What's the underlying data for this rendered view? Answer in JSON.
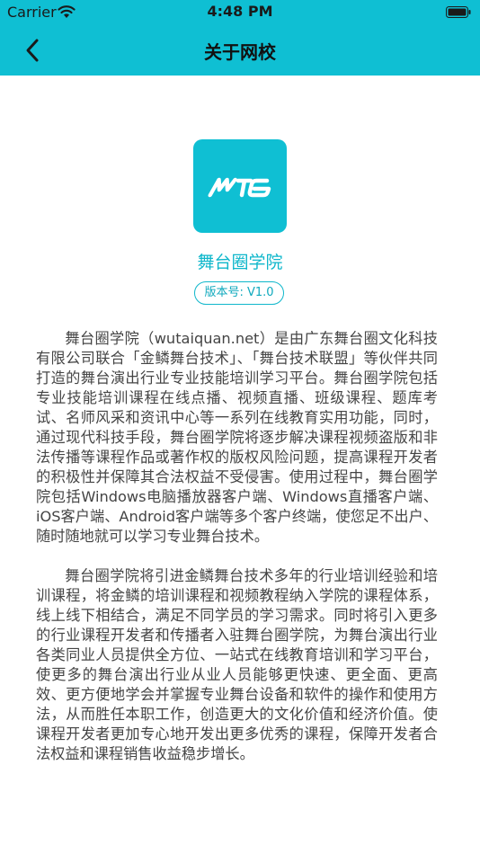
{
  "status_bar": {
    "carrier": "Carrier",
    "time": "4:48 PM"
  },
  "nav": {
    "title": "关于网校",
    "back_icon": "chevron-left-icon"
  },
  "app": {
    "logo_text": "WTQ",
    "name": "舞台圈学院",
    "version": "版本号: V1.0"
  },
  "description": {
    "paragraphs": [
      "舞台圈学院（wutaiquan.net）是由广东舞台圈文化科技有限公司联合「金鳞舞台技术」、「舞台技术联盟」等伙伴共同打造的舞台演出行业专业技能培训学习平台。舞台圈学院包括专业技能培训课程在线点播、视频直播、班级课程、题库考试、名师风采和资讯中心等一系列在线教育实用功能，同时，通过现代科技手段，舞台圈学院将逐步解决课程视频盗版和非法传播等课程作品或著作权的版权风险问题，提高课程开发者的积极性并保障其合法权益不受侵害。使用过程中，舞台圈学院包括Windows电脑播放器客户端、Windows直播客户端、iOS客户端、Android客户端等多个客户终端，使您足不出户、随时随地就可以学习专业舞台技术。",
      "舞台圈学院将引进金鳞舞台技术多年的行业培训经验和培训课程，将金鳞的培训课程和视频教程纳入学院的课程体系，线上线下相结合，满足不同学员的学习需求。同时将引入更多的行业课程开发者和传播者入驻舞台圈学院，为舞台演出行业各类同业人员提供全方位、一站式在线教育培训和学习平台，使更多的舞台演出行业从业人员能够更快速、更全面、更高效、更方便地学会并掌握专业舞台设备和软件的操作和使用方法，从而胜任本职工作，创造更大的文化价值和经济价值。使课程开发者更加专心地开发出更多优秀的课程，保障开发者合法权益和课程销售收益稳步增长。"
    ]
  },
  "colors": {
    "accent": "#0fbfd3",
    "text": "#444444"
  }
}
